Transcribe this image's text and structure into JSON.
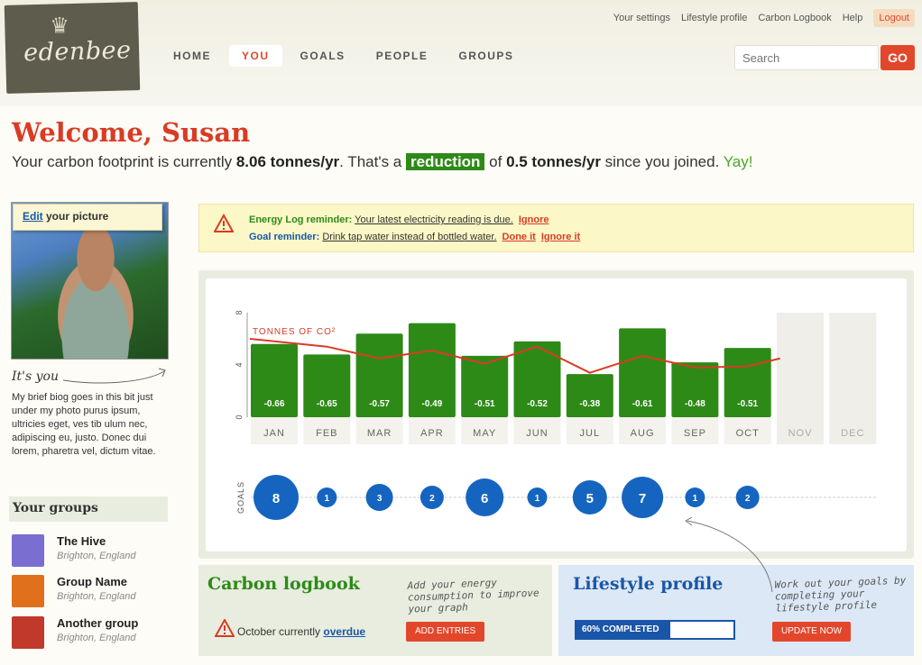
{
  "logo": {
    "name": "edenbee",
    "icon": "bee-crown-icon"
  },
  "nav": [
    "HOME",
    "YOU",
    "GOALS",
    "PEOPLE",
    "GROUPS"
  ],
  "nav_active": "YOU",
  "top_links": [
    "Your settings",
    "Lifestyle profile",
    "Carbon Logbook",
    "Help"
  ],
  "logout": "Logout",
  "search": {
    "placeholder": "Search",
    "button": "GO"
  },
  "welcome": "Welcome, Susan",
  "footprint": {
    "p1": "Your carbon footprint is currently ",
    "value": "8.06 tonnes/yr",
    "p2": ". That's a ",
    "badge": "reduction",
    "p3": " of ",
    "delta": "0.5 tonnes/yr",
    "p4": " since you joined. ",
    "yay": "Yay!"
  },
  "profile": {
    "edit_link": "Edit",
    "edit_rest": " your picture",
    "its_you": "It's you",
    "bio": "My brief biog goes in this bit just under my photo purus ipsum, ultricies eget, ves tib ulum nec, adipiscing eu, justo. Donec dui lorem, pharetra vel, dictum vitae."
  },
  "groups": {
    "title": "Your groups",
    "items": [
      {
        "name": "The Hive",
        "location": "Brighton, England",
        "color": "#7a6fd1"
      },
      {
        "name": "Group Name",
        "location": "Brighton, England",
        "color": "#e0701c"
      },
      {
        "name": "Another group",
        "location": "Brighton, England",
        "color": "#c0392b"
      }
    ]
  },
  "reminders": {
    "energy_label": "Energy Log reminder:",
    "energy_text": "Your latest electricity reading is due.",
    "energy_ignore": "Ignore",
    "goal_label": "Goal reminder:",
    "goal_text": "Drink tap water instead of bottled water.",
    "goal_done": "Done it",
    "goal_ignore": "Ignore it"
  },
  "chart_data": {
    "type": "bar",
    "categories": [
      "JAN",
      "FEB",
      "MAR",
      "APR",
      "MAY",
      "JUN",
      "JUL",
      "AUG",
      "SEP",
      "OCT",
      "NOV",
      "DEC"
    ],
    "values": [
      5.6,
      4.8,
      6.4,
      7.2,
      4.7,
      5.8,
      3.3,
      6.8,
      4.2,
      5.3,
      null,
      null
    ],
    "labels": [
      "-0.66",
      "-0.65",
      "-0.57",
      "-0.49",
      "-0.51",
      "-0.52",
      "-0.38",
      "-0.61",
      "-0.48",
      "-0.51",
      "",
      ""
    ],
    "line": {
      "name": "TONNES OF CO²",
      "values": [
        6.0,
        5.4,
        4.5,
        5.1,
        4.1,
        5.4,
        3.4,
        4.7,
        3.8,
        3.9,
        null,
        null
      ],
      "end": 4.5
    },
    "ylim": [
      0,
      8
    ],
    "yticks": [
      0,
      4,
      8
    ],
    "goals_label": "GOALS",
    "goals": [
      8,
      1,
      3,
      2,
      6,
      1,
      5,
      7,
      1,
      2
    ],
    "colors": {
      "bar": "#2e8a17",
      "line": "#d93b24",
      "goal": "#1565c0",
      "empty": "#efeee8"
    }
  },
  "logbook": {
    "title": "Carbon logbook",
    "note": "Add your energy consumption to improve your graph",
    "status_text": "October currently",
    "status_link": "overdue",
    "button": "ADD ENTRIES"
  },
  "lifestyle": {
    "title": "Lifestyle profile",
    "note": "Work out your goals by completing your lifestyle profile",
    "progress_label": "60% COMPLETED",
    "progress": 0.6,
    "button": "UPDATE NOW"
  }
}
